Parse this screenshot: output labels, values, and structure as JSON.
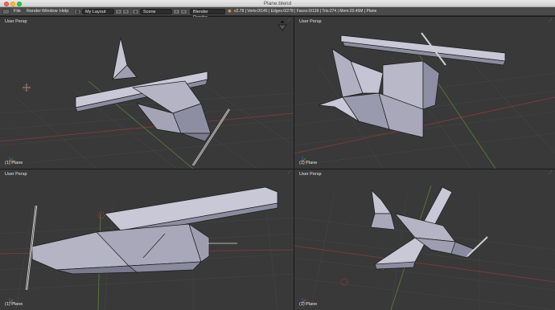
{
  "window": {
    "title": "Plane.blend"
  },
  "infobar": {
    "menus": [
      "File",
      "Render",
      "Window",
      "Help"
    ],
    "layout_name": "My Layout",
    "scene_name": "Scene",
    "render_engine": "Blender Render",
    "stats": "v2.78 | Verts:0/145 | Edges:0/278 | Faces:0/139 | Tris:274 | Mem:20.45M | Plane"
  },
  "viewports": [
    {
      "id": "top-left",
      "view_label": "User Persp",
      "object_label": "(1) Plane"
    },
    {
      "id": "top-right",
      "view_label": "User Persp",
      "object_label": "(1) Plane"
    },
    {
      "id": "bottom-left",
      "view_label": "User Persp",
      "object_label": "(1) Plane"
    },
    {
      "id": "bottom-right",
      "view_label": "User Persp",
      "object_label": "(1) Plane"
    }
  ],
  "colors": {
    "viewport_bg": "#393939",
    "grid": "#454545",
    "mesh_face": "#b8b8c8",
    "mesh_edge": "#1a1a1a",
    "axis_x": "#8a3b3b",
    "axis_y": "#5c7d3b"
  }
}
